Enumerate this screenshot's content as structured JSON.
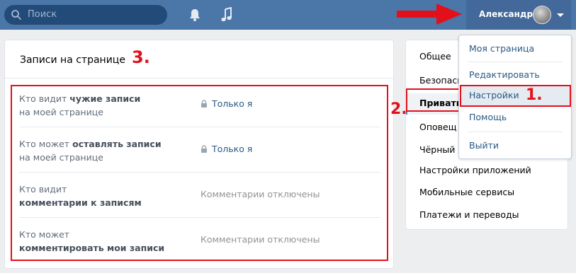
{
  "topbar": {
    "search_placeholder": "Поиск",
    "icons": [
      "search-icon",
      "bell-icon",
      "music-icon"
    ],
    "user_name": "Александр"
  },
  "panel": {
    "title": "Записи на странице",
    "rows": [
      {
        "line1_plain": "Кто видит ",
        "line1_bold": "чужие записи",
        "line2_plain": "на моей странице",
        "line2_bold": "",
        "value": "Только я",
        "locked": true
      },
      {
        "line1_plain": "Кто может ",
        "line1_bold": "оставлять записи",
        "line2_plain": "на моей странице",
        "line2_bold": "",
        "value": "Только я",
        "locked": true
      },
      {
        "line1_plain": "Кто видит",
        "line1_bold": "",
        "line2_plain": "",
        "line2_bold": "комментарии к записям",
        "value": "Комментарии отключены",
        "locked": false
      },
      {
        "line1_plain": "Кто может",
        "line1_bold": "",
        "line2_plain": "",
        "line2_bold": "комментировать мои записи",
        "value": "Комментарии отключены",
        "locked": false
      }
    ]
  },
  "settings_menu": {
    "items": [
      "Общее",
      "Безопасн",
      "Приватн",
      "Оповещ",
      "Чёрный с",
      "Настройки приложений",
      "Мобильные сервисы",
      "Платежи и переводы"
    ],
    "active_index": 2
  },
  "dropdown": {
    "items": [
      "Моя страница",
      "Редактировать",
      "Настройки",
      "Помощь",
      "Выйти"
    ],
    "active_index": 2
  },
  "annotations": {
    "label_1": "1.",
    "label_2": "2.",
    "label_3": "3.",
    "color": "#e3101b"
  },
  "colors": {
    "header": "#4a76a8",
    "link": "#2a5885",
    "background": "#edeef0"
  }
}
